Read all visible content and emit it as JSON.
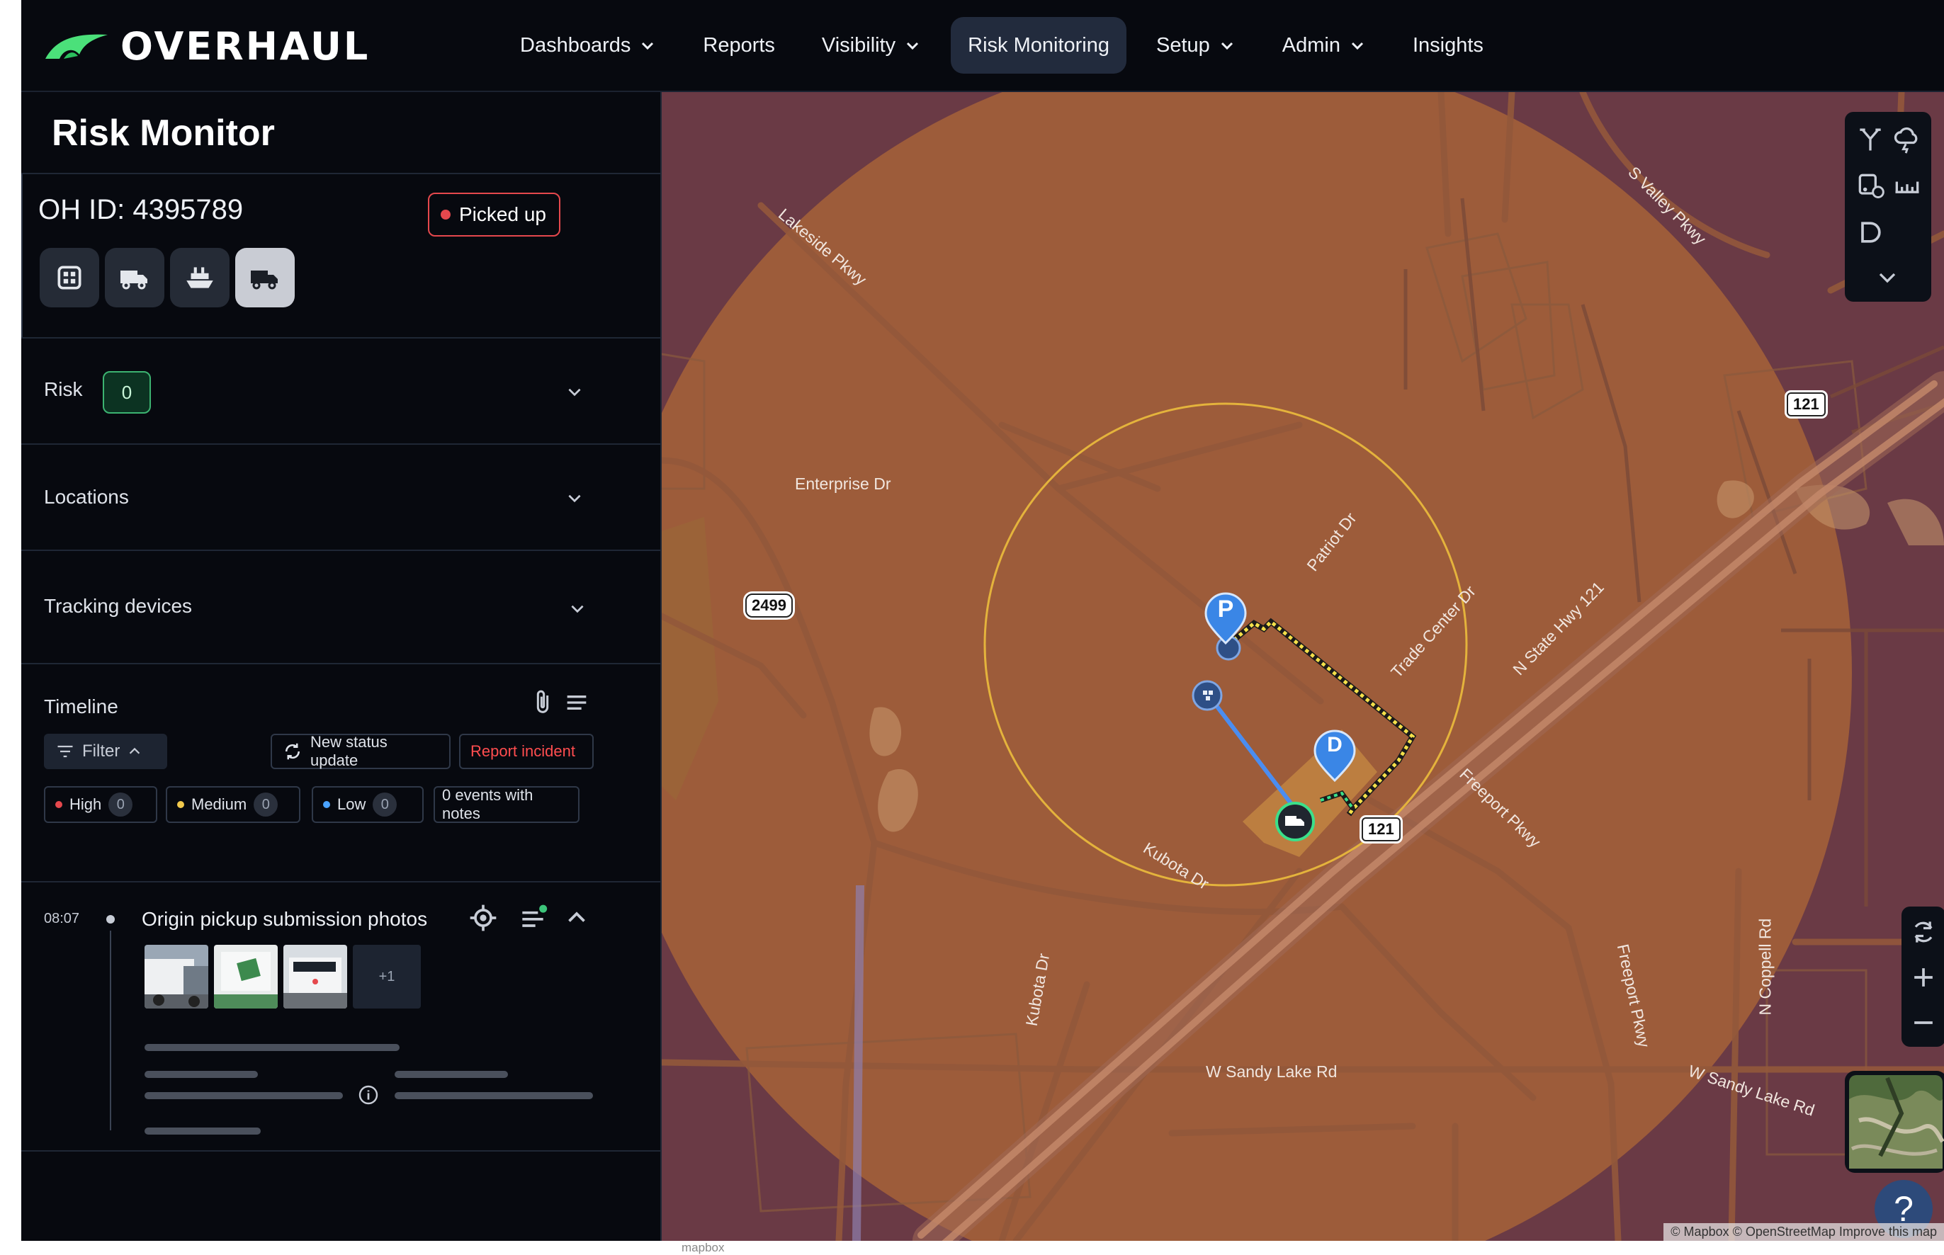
{
  "app": {
    "brand": "OVERHAUL",
    "nav": [
      {
        "label": "Dashboards",
        "dropdown": true,
        "active": false
      },
      {
        "label": "Reports",
        "dropdown": false,
        "active": false
      },
      {
        "label": "Visibility",
        "dropdown": true,
        "active": false
      },
      {
        "label": "Risk Monitoring",
        "dropdown": false,
        "active": true
      },
      {
        "label": "Setup",
        "dropdown": true,
        "active": false
      },
      {
        "label": "Admin",
        "dropdown": true,
        "active": false
      },
      {
        "label": "Insights",
        "dropdown": false,
        "active": false
      }
    ]
  },
  "panel": {
    "title": "Risk Monitor",
    "shipment": {
      "id_label": "OH ID: 4395789",
      "status": "Picked up",
      "status_color": "#e5484d",
      "modes": [
        "grid-icon",
        "truck-icon",
        "ship-icon",
        "truck-active-icon"
      ]
    },
    "sections": {
      "risk": {
        "label": "Risk",
        "count": "0"
      },
      "locations": {
        "label": "Locations"
      },
      "tracking": {
        "label": "Tracking devices"
      }
    },
    "timeline": {
      "title": "Timeline",
      "filter_label": "Filter",
      "status_update_label": "New status update",
      "report_label": "Report incident",
      "severities": [
        {
          "label": "High",
          "count": "0",
          "color": "#e5484d"
        },
        {
          "label": "Medium",
          "count": "0",
          "color": "#f2c94c"
        },
        {
          "label": "Low",
          "count": "0",
          "color": "#4aa3ff"
        }
      ],
      "notes_label": "0 events with notes",
      "events": [
        {
          "time": "08:07",
          "title": "Origin pickup submission photos",
          "more_photos": "+1"
        }
      ]
    }
  },
  "map": {
    "labels": {
      "lakeside": "Lakeside Pkwy",
      "enterprise": "Enterprise Dr",
      "svalley": "S Valley Pkwy",
      "patriot": "Patriot Dr",
      "tradecenter": "Trade Center Dr",
      "nstate": "N State Hwy 121",
      "freeport1": "Freeport Pkwy",
      "freeport2": "Freeport Pkwy",
      "kubota1": "Kubota Dr",
      "kubota2": "Kubota Dr",
      "ncoppell": "N Coppell Rd",
      "sandy1": "W Sandy Lake Rd",
      "sandy2": "W Sandy Lake Rd"
    },
    "shields": {
      "hwy121_a": "121",
      "hwy121_b": "121",
      "fm2499": "2499"
    },
    "markers": {
      "pickup": "P",
      "delivery": "D"
    },
    "attribution": "© Mapbox © OpenStreetMap  Improve this map",
    "mapbox": "mapbox",
    "help": "?"
  }
}
